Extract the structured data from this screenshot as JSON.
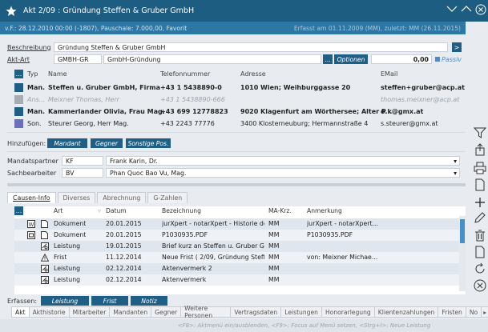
{
  "title": "Akt 2/09 : Gründung Steffen & Gruber GmbH",
  "info": {
    "left": "v.F.: 28.12.2010 00:00 (-1807), Pauschale: 7.000,00, Favorit",
    "right": "Erfasst am 01.11.2009 (MM), zuletzt: MM (26.11.2015)"
  },
  "form": {
    "beschreibung_label": "Beschreibung",
    "beschreibung_value": "Gründung Steffen & Gruber GmbH",
    "aktart_label": "Akt-Art",
    "aktart_code": "GMBH-GR",
    "aktart_value": "GmbH-Gründung",
    "optionen_label": "Optionen",
    "amount": "0,00",
    "passiv_label": "Passiv",
    "ellipsis": "...",
    "go": ">"
  },
  "contacts": {
    "headers": {
      "typ": "Typ",
      "name": "Name",
      "tel": "Telefonnummer",
      "addr": "Adresse",
      "mail": "EMail"
    },
    "rows": [
      {
        "typ": "Man.",
        "name": "Steffen u. Gruber GmbH, Firma",
        "tel": "+43 1 5438890-0",
        "addr": "1010 Wien; Weihburggasse 20",
        "mail": "steffen+gruber@acp.at",
        "color": "#1f5f86",
        "style": "bold"
      },
      {
        "typ": "Ans...",
        "name": "Meixner Thomas, Herr",
        "tel": "+43 1 5438890-666",
        "addr": "",
        "mail": "thomas.meixner@acp.at",
        "color": "#a8adb3",
        "style": "dim"
      },
      {
        "typ": "Man.",
        "name": "Kammerlander Olivia, Frau Mag.",
        "tel": "+43 699 12778823",
        "addr": "9020 Klagenfurt am Wörthersee; Alter P...",
        "mail": "o.k@gmx.at",
        "color": "#1f5f86",
        "style": "bold"
      },
      {
        "typ": "Son.",
        "name": "Steurer Georg, Herr Mag.",
        "tel": "+43 2243 77776",
        "addr": "3400 Klosterneuburg; Hermannstraße 4",
        "mail": "s.steurer@gmx.at",
        "color": "#6c6fc0",
        "style": "normal"
      }
    ]
  },
  "hinzufuegen": {
    "label": "Hinzufügen:",
    "buttons": [
      "Mandant",
      "Gegner",
      "Sonstige Pos."
    ]
  },
  "mandatspartner": {
    "label": "Mandatspartner",
    "code": "KF",
    "name": "Frank Karin, Dr."
  },
  "sachbearbeiter": {
    "label": "Sachbearbeiter",
    "code": "BV",
    "name": "Phan Quoc Bao Vu, Mag."
  },
  "tabs": [
    "Causen-Info",
    "Diverses",
    "Abrechnung",
    "G-Zahlen"
  ],
  "grid": {
    "headers": {
      "art": "Art",
      "datum": "Datum",
      "bez": "Bezeichnung",
      "ma": "MA-Krz.",
      "anm": "Anmerkung"
    },
    "rows": [
      {
        "icon": "word-doc-icon",
        "art": "Dokument",
        "datum": "20.01.2015",
        "bez": "jurXpert - notarXpert - Historie der V...",
        "ma": "MM",
        "anm": "jurXpert - notarXpert..."
      },
      {
        "icon": "pdf-doc-icon",
        "art": "Dokument",
        "datum": "20.01.2015",
        "bez": "P1030935.PDF",
        "ma": "MM",
        "anm": "P1030935.PDF"
      },
      {
        "icon": "leistung-icon",
        "art": "Leistung",
        "datum": "19.01.2015",
        "bez": "Brief kurz an Steffen u. Gruber Gmb...",
        "ma": "MM",
        "anm": ""
      },
      {
        "icon": "warning-icon",
        "art": "Frist",
        "datum": "11.12.2014",
        "bez": "Neue Frist ( 2/09, Gründung Steffen ...",
        "ma": "MM",
        "anm": "von: Meixner Michae..."
      },
      {
        "icon": "leistung-icon",
        "art": "Leistung",
        "datum": "02.12.2014",
        "bez": "Aktenvermerk 2",
        "ma": "MM",
        "anm": ""
      },
      {
        "icon": "leistung-icon",
        "art": "Leistung",
        "datum": "02.12.2014",
        "bez": "Aktenvermerk",
        "ma": "MM",
        "anm": ""
      }
    ]
  },
  "erfassen": {
    "label": "Erfassen:",
    "buttons": [
      "Leistung",
      "Frist",
      "Notiz"
    ]
  },
  "bottom_tabs": [
    "Akt",
    "Akthistorie",
    "Mitarbeiter",
    "Mandanten",
    "Gegner",
    "Weitere Personen",
    "Vertragsdaten",
    "Leistungen",
    "Honorarlegung",
    "Klientenzahlungen",
    "Fristen",
    "No"
  ],
  "status": "<F8>: Aktmenü ein/ausblenden, <F9>: Focus auf Menü setzen, <Strg+I>: Neue Leistung",
  "colors": {
    "titlebar": "#1d5d82",
    "infobar": "#2d77a5",
    "accent": "#1f5f86"
  }
}
